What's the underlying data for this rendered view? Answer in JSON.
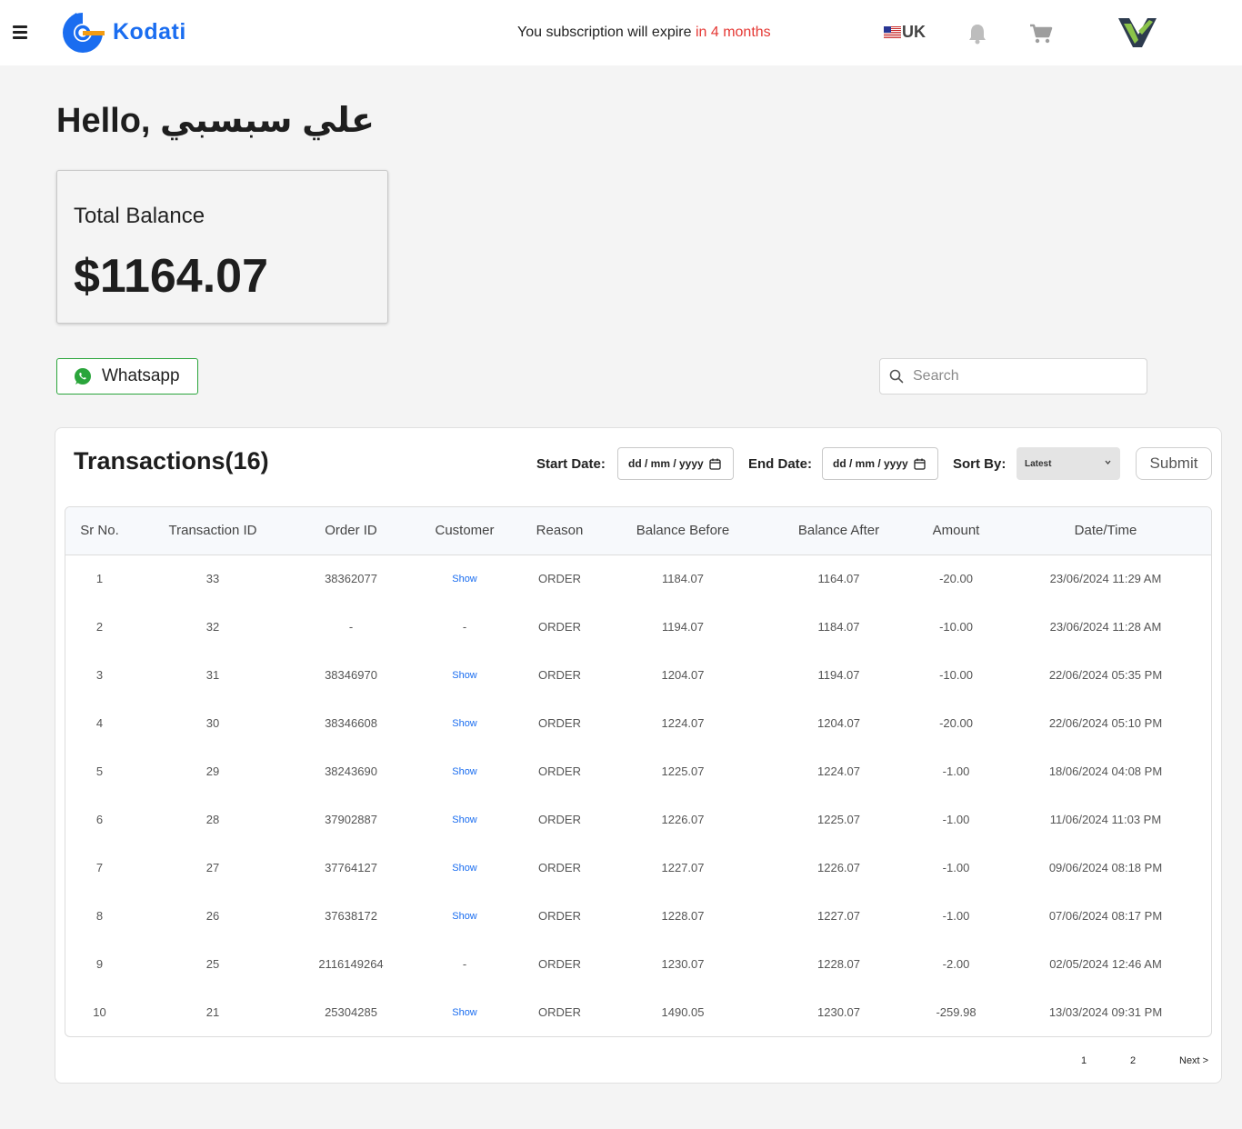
{
  "header": {
    "logo_text": "Kodati",
    "subscription_prefix": "You subscription will expire ",
    "subscription_highlight": "in 4 months",
    "region": "UK",
    "icons": [
      "menu-icon",
      "bell-icon",
      "cart-icon"
    ],
    "colors": {
      "brand": "#1a6df0",
      "expiry": "#e53935",
      "whatsapp": "#2aa53b"
    }
  },
  "greeting": "Hello, علي سبسبي",
  "balance": {
    "label": "Total Balance",
    "value": "$1164.07"
  },
  "whatsapp": {
    "label": "Whatsapp"
  },
  "search": {
    "placeholder": "Search"
  },
  "transactions": {
    "title": "Transactions(16)",
    "start_label": "Start Date:",
    "end_label": "End Date:",
    "date_placeholder": "dd / mm / yyyy",
    "sort_label": "Sort By:",
    "sort_value": "Latest",
    "submit_label": "Submit",
    "columns": [
      "Sr No.",
      "Transaction ID",
      "Order ID",
      "Customer",
      "Reason",
      "Balance Before",
      "Balance After",
      "Amount",
      "Date/Time"
    ],
    "rows": [
      {
        "sr": "1",
        "txn": "33",
        "order": "38362077",
        "customer": "Show",
        "reason": "ORDER",
        "before": "1184.07",
        "after": "1164.07",
        "amount": "-20.00",
        "datetime": "23/06/2024 11:29 AM"
      },
      {
        "sr": "2",
        "txn": "32",
        "order": "-",
        "customer": "-",
        "reason": "ORDER",
        "before": "1194.07",
        "after": "1184.07",
        "amount": "-10.00",
        "datetime": "23/06/2024 11:28 AM"
      },
      {
        "sr": "3",
        "txn": "31",
        "order": "38346970",
        "customer": "Show",
        "reason": "ORDER",
        "before": "1204.07",
        "after": "1194.07",
        "amount": "-10.00",
        "datetime": "22/06/2024 05:35 PM"
      },
      {
        "sr": "4",
        "txn": "30",
        "order": "38346608",
        "customer": "Show",
        "reason": "ORDER",
        "before": "1224.07",
        "after": "1204.07",
        "amount": "-20.00",
        "datetime": "22/06/2024 05:10 PM"
      },
      {
        "sr": "5",
        "txn": "29",
        "order": "38243690",
        "customer": "Show",
        "reason": "ORDER",
        "before": "1225.07",
        "after": "1224.07",
        "amount": "-1.00",
        "datetime": "18/06/2024 04:08 PM"
      },
      {
        "sr": "6",
        "txn": "28",
        "order": "37902887",
        "customer": "Show",
        "reason": "ORDER",
        "before": "1226.07",
        "after": "1225.07",
        "amount": "-1.00",
        "datetime": "11/06/2024 11:03 PM"
      },
      {
        "sr": "7",
        "txn": "27",
        "order": "37764127",
        "customer": "Show",
        "reason": "ORDER",
        "before": "1227.07",
        "after": "1226.07",
        "amount": "-1.00",
        "datetime": "09/06/2024 08:18 PM"
      },
      {
        "sr": "8",
        "txn": "26",
        "order": "37638172",
        "customer": "Show",
        "reason": "ORDER",
        "before": "1228.07",
        "after": "1227.07",
        "amount": "-1.00",
        "datetime": "07/06/2024 08:17 PM"
      },
      {
        "sr": "9",
        "txn": "25",
        "order": "2116149264",
        "customer": "-",
        "reason": "ORDER",
        "before": "1230.07",
        "after": "1228.07",
        "amount": "-2.00",
        "datetime": "02/05/2024 12:46 AM"
      },
      {
        "sr": "10",
        "txn": "21",
        "order": "25304285",
        "customer": "Show",
        "reason": "ORDER",
        "before": "1490.05",
        "after": "1230.07",
        "amount": "-259.98",
        "datetime": "13/03/2024 09:31 PM"
      }
    ]
  },
  "pagination": {
    "pages": [
      "1",
      "2"
    ],
    "next": "Next >"
  }
}
